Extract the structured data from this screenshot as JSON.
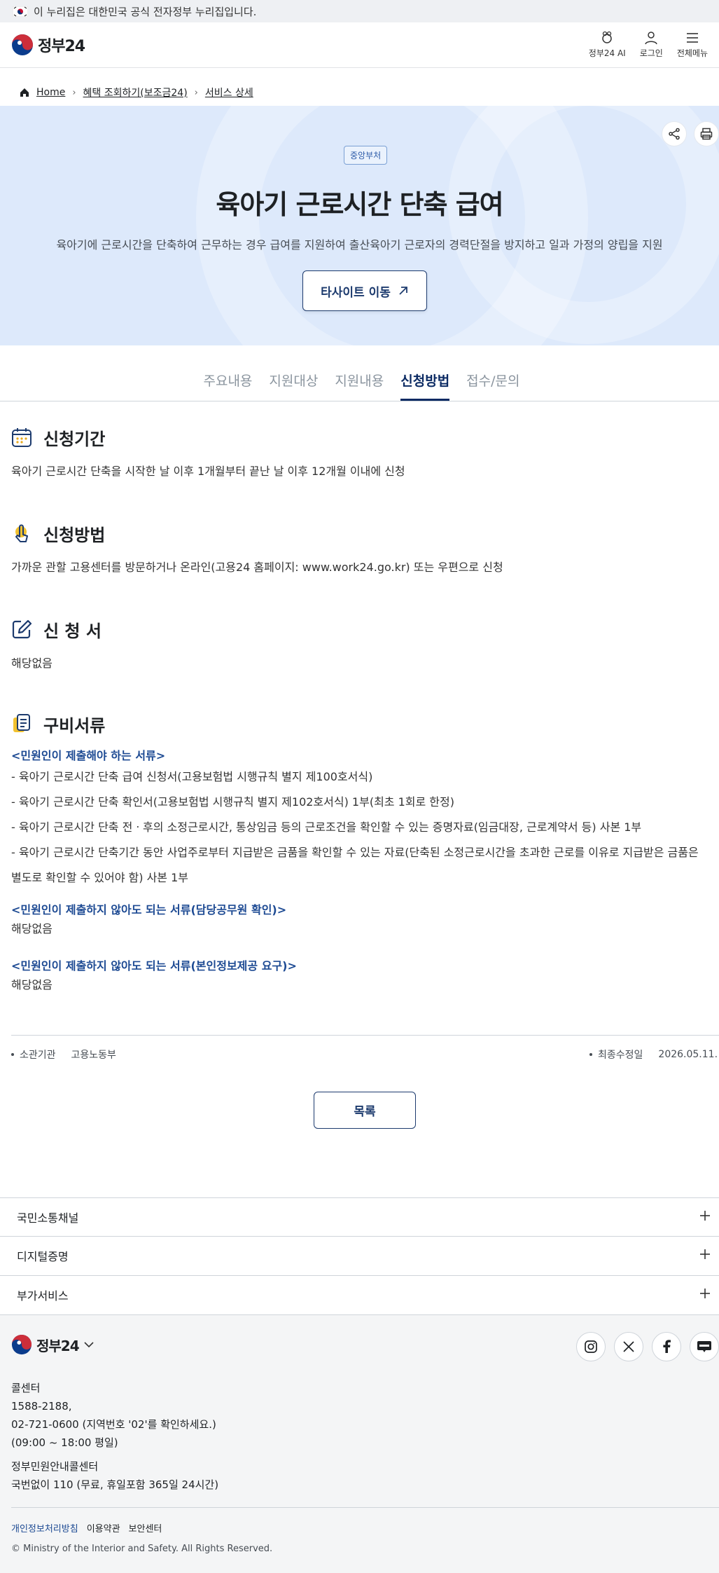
{
  "gov_banner": {
    "text": "이 누리집은 대한민국 공식 전자정부 누리집입니다."
  },
  "header": {
    "logo_text": "정부24",
    "actions": [
      {
        "label": "정부24 AI",
        "icon": "ai-mascot-icon"
      },
      {
        "label": "로그인",
        "icon": "user-icon"
      },
      {
        "label": "전체메뉴",
        "icon": "hamburger-menu-icon"
      }
    ]
  },
  "breadcrumb": {
    "home": "Home",
    "items": [
      "혜택 조회하기(보조금24)",
      "서비스 상세"
    ]
  },
  "hero": {
    "badge": "중앙부처",
    "title": "육아기 근로시간 단축 급여",
    "description": "육아기에 근로시간을 단축하여 근무하는 경우 급여를 지원하여 출산육아기 근로자의 경력단절을 방지하고 일과 가정의 양립을 지원",
    "button_label": "타사이트 이동"
  },
  "tabs": [
    {
      "label": "주요내용",
      "active": false
    },
    {
      "label": "지원대상",
      "active": false
    },
    {
      "label": "지원내용",
      "active": false
    },
    {
      "label": "신청방법",
      "active": true
    },
    {
      "label": "접수/문의",
      "active": false
    }
  ],
  "sections": {
    "period": {
      "title": "신청기간",
      "body": "육아기 근로시간 단축을 시작한 날 이후 1개월부터 끝난 날 이후 12개월 이내에 신청"
    },
    "method": {
      "title": "신청방법",
      "body": "가까운 관할 고용센터를 방문하거나 온라인(고용24 홈페이지: www.work24.go.kr) 또는 우편으로 신청"
    },
    "form": {
      "title": "신 청 서",
      "body": "해당없음"
    },
    "documents": {
      "title": "구비서류",
      "required_heading": "<민원인이 제출해야 하는 서류>",
      "required_items": [
        "- 육아기 근로시간 단축 급여 신청서(고용보험법 시행규칙 별지 제100호서식)",
        "- 육아기 근로시간 단축 확인서(고용보험법 시행규칙 별지 제102호서식) 1부(최초 1회로 한정)",
        "- 육아기 근로시간 단축 전ㆍ후의 소정근로시간, 통상임금 등의 근로조건을 확인할 수 있는 증명자료(임금대장, 근로계약서 등) 사본 1부",
        "- 육아기 근로시간 단축기간 동안 사업주로부터 지급받은 금품을 확인할 수 있는 자료(단축된 소정근로시간을 초과한 근로를 이유로 지급받은 금품은",
        "별도로 확인할 수 있어야 함) 사본 1부"
      ],
      "official_heading": "<민원인이 제출하지 않아도 되는 서류(담당공무원 확인)>",
      "official_body": "해당없음",
      "self_heading": "<민원인이 제출하지 않아도 되는 서류(본인정보제공 요구)>",
      "self_body": "해당없음"
    }
  },
  "meta": {
    "agency_label": "소관기관",
    "agency_value": "고용노동부",
    "updated_label": "최종수정일",
    "updated_value": "2026.05.11."
  },
  "list_button": "목록",
  "accordions": [
    "국민소통채널",
    "디지털증명",
    "부가서비스"
  ],
  "footer": {
    "logo_text": "정부24",
    "social": [
      "instagram-icon",
      "x-icon",
      "facebook-icon",
      "blog-icon"
    ],
    "contact_lines": [
      "콜센터",
      "1588-2188,",
      "02-721-0600 (지역번호 '02'를 확인하세요.)",
      "(09:00 ~ 18:00 평일)"
    ],
    "contact_lines2": [
      "정부민원안내콜센터",
      "국번없이 110 (무료, 휴일포함 365일 24시간)"
    ],
    "links": [
      "개인정보처리방침",
      "이용약관",
      "보안센터"
    ],
    "copyright": "© Ministry of the Interior and Safety. All Rights Reserved."
  },
  "colors": {
    "accent": "#1d3b6e",
    "hero_bg": "#dde9fb",
    "active_tab": "#0b2a63",
    "doc_heading": "#1d4a93"
  }
}
